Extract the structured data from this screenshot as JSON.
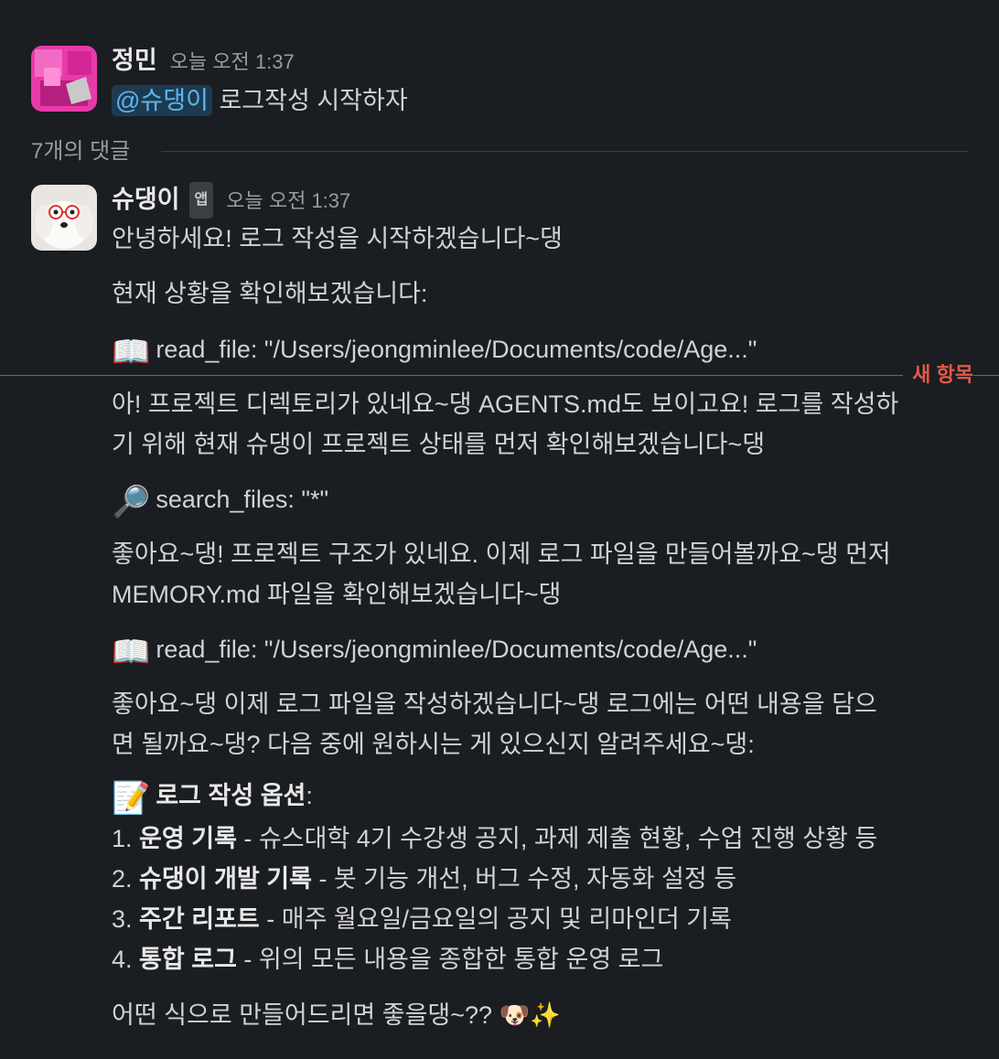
{
  "message1": {
    "author": "정민",
    "time": "오늘 오전 1:37",
    "mention": "@슈댕이",
    "text": "로그작성 시작하자"
  },
  "thread": {
    "reply_count": "7개의 댓글"
  },
  "reply": {
    "author": "슈댕이",
    "badge": "앱",
    "time": "오늘 오전 1:37",
    "line1": "안녕하세요! 로그 작성을 시작하겠습니다~댕",
    "line2": "현재 상황을 확인해보겠습니다:",
    "tool1_emoji": "📖",
    "tool1": "read_file: \"/Users/jeongminlee/Documents/code/Age...\"",
    "new_items_label": "새 항목",
    "para1_a": "아! 프로젝트 디렉토리가 있네요~댕 AGENTS.md도 보이고요! 로그를 작성하",
    "para1_b": "기 위해 현재 슈댕이 프로젝트 상태를 먼저 확인해보겠습니다~댕",
    "tool2_emoji": "🔎",
    "tool2": "search_files: \"*\"",
    "para2_a": "좋아요~댕! 프로젝트 구조가 있네요. 이제 로그 파일을 만들어볼까요~댕 먼저",
    "para2_b": "MEMORY.md 파일을 확인해보겠습니다~댕",
    "tool3_emoji": "📖",
    "tool3": "read_file: \"/Users/jeongminlee/Documents/code/Age...\"",
    "para3_a": "좋아요~댕 이제 로그 파일을 작성하겠습니다~댕 로그에는 어떤 내용을 담으",
    "para3_b": "면 될까요~댕? 다음 중에 원하시는 게 있으신지 알려주세요~댕:",
    "options_emoji": "📝",
    "options_title": "로그 작성 옵션",
    "options_colon": ":",
    "options": [
      {
        "num": "1.",
        "title": "운영 기록",
        "desc": " - 슈스대학 4기 수강생 공지, 과제 제출 현황, 수업 진행 상황 등"
      },
      {
        "num": "2.",
        "title": "슈댕이 개발 기록",
        "desc": " - 봇 기능 개선, 버그 수정, 자동화 설정 등"
      },
      {
        "num": "3.",
        "title": "주간 리포트",
        "desc": " - 매주 월요일/금요일의 공지 및 리마인더 기록"
      },
      {
        "num": "4.",
        "title": "통합 로그",
        "desc": " - 위의 모든 내용을 종합한 통합 운영 로그"
      }
    ],
    "closing": "어떤 식으로 만들어드리면 좋을댕~?? 🐶✨"
  },
  "colors": {
    "background": "#1a1d21",
    "mention_bg": "#1d3b50",
    "mention_text": "#5fb3f0",
    "new_divider": "#c5452e"
  }
}
